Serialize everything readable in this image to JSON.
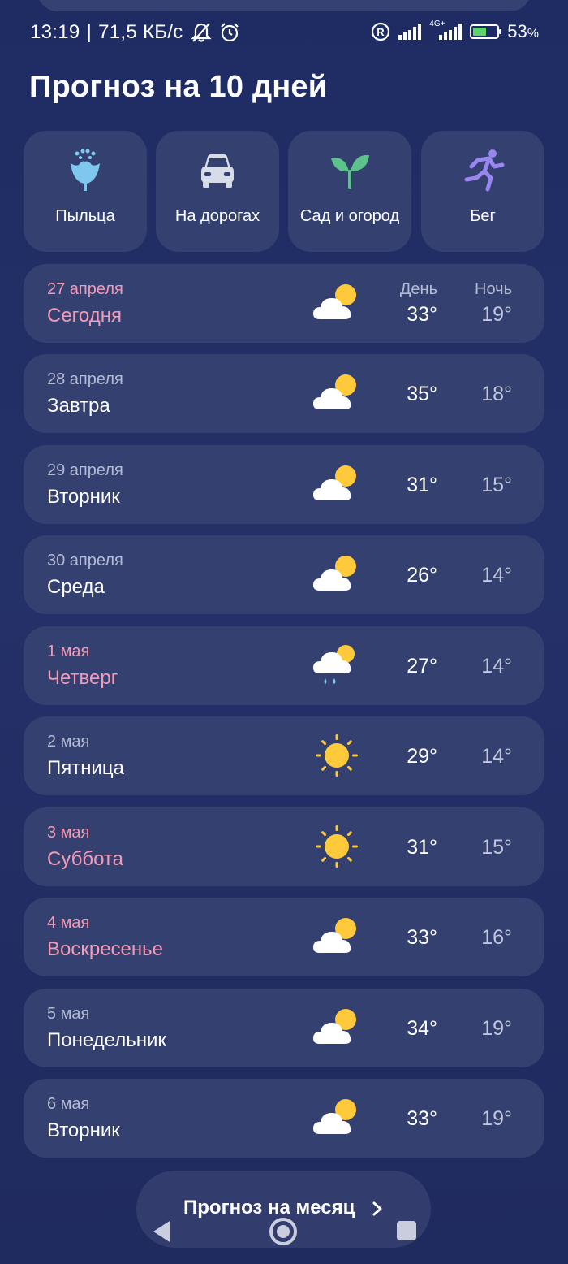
{
  "status_bar": {
    "time": "13:19",
    "separator": "|",
    "speed": "71,5 КБ/с",
    "network_label": "4G+",
    "battery_percent": "53",
    "percent_sign": "%",
    "icons": [
      "notifications-off-icon",
      "alarm-icon",
      "registered-icon",
      "signal-icon",
      "signal-4g-icon",
      "battery-charging-icon"
    ]
  },
  "title": "Прогноз на 10 дней",
  "categories": [
    {
      "label": "Пыльца",
      "icon": "flower-icon",
      "color": "#7ec8ee"
    },
    {
      "label": "На дорогах",
      "icon": "car-icon",
      "color": "#d6dde8"
    },
    {
      "label": "Сад и огород",
      "icon": "sprout-icon",
      "color": "#5cc38a"
    },
    {
      "label": "Бег",
      "icon": "runner-icon",
      "color": "#9a86f0"
    }
  ],
  "columns": {
    "day": "День",
    "night": "Ночь"
  },
  "days": [
    {
      "date": "27 апреля",
      "name": "Сегодня",
      "weather": "partly-cloudy",
      "day_temp": "33°",
      "night_temp": "19°",
      "highlight": true
    },
    {
      "date": "28 апреля",
      "name": "Завтра",
      "weather": "partly-cloudy",
      "day_temp": "35°",
      "night_temp": "18°",
      "highlight": false
    },
    {
      "date": "29 апреля",
      "name": "Вторник",
      "weather": "partly-cloudy",
      "day_temp": "31°",
      "night_temp": "15°",
      "highlight": false
    },
    {
      "date": "30 апреля",
      "name": "Среда",
      "weather": "partly-cloudy",
      "day_temp": "26°",
      "night_temp": "14°",
      "highlight": false
    },
    {
      "date": "1 мая",
      "name": "Четверг",
      "weather": "light-rain",
      "day_temp": "27°",
      "night_temp": "14°",
      "highlight": true
    },
    {
      "date": "2 мая",
      "name": "Пятница",
      "weather": "sunny",
      "day_temp": "29°",
      "night_temp": "14°",
      "highlight": false
    },
    {
      "date": "3 мая",
      "name": "Суббота",
      "weather": "sunny",
      "day_temp": "31°",
      "night_temp": "15°",
      "highlight": true
    },
    {
      "date": "4 мая",
      "name": "Воскресенье",
      "weather": "partly-cloudy",
      "day_temp": "33°",
      "night_temp": "16°",
      "highlight": true
    },
    {
      "date": "5 мая",
      "name": "Понедельник",
      "weather": "partly-cloudy",
      "day_temp": "34°",
      "night_temp": "19°",
      "highlight": false
    },
    {
      "date": "6 мая",
      "name": "Вторник",
      "weather": "partly-cloudy",
      "day_temp": "33°",
      "night_temp": "19°",
      "highlight": false
    }
  ],
  "month_button": {
    "label": "Прогноз на месяц",
    "icon": "chevron-right-icon"
  },
  "nav_bar": {
    "icons": [
      "nav-back-icon",
      "nav-home-icon",
      "nav-recents-icon"
    ]
  },
  "colors": {
    "background": "#223066",
    "card": "#34406f",
    "weekend_text": "#f49ab7",
    "secondary_text": "#b3bbd6",
    "sun": "#ffc93c"
  }
}
